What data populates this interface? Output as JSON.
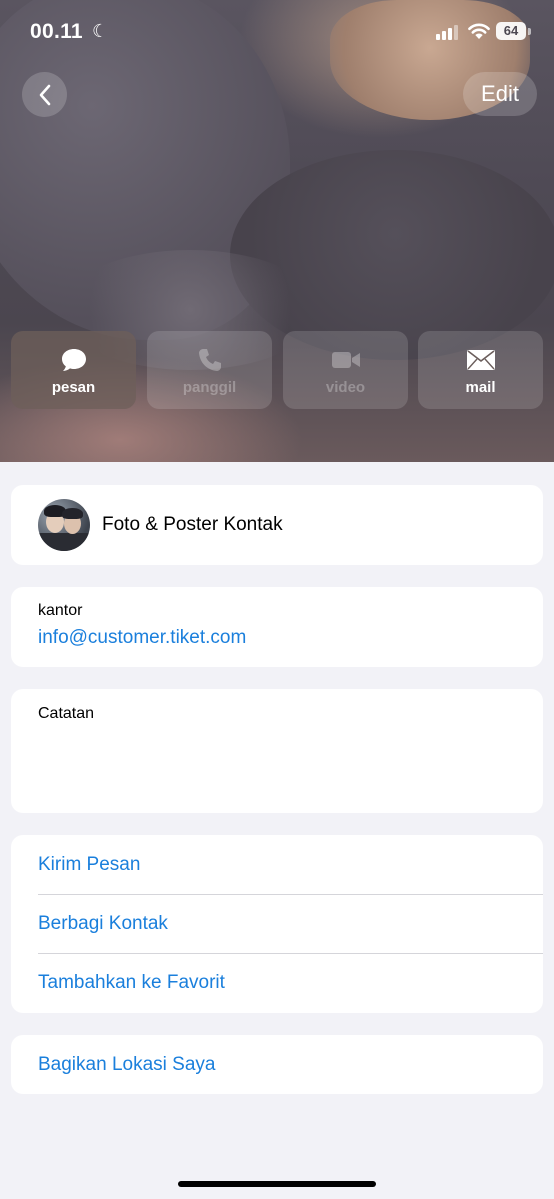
{
  "status_bar": {
    "time": "00.11",
    "focus_icon": "moon-icon",
    "battery": "64"
  },
  "header": {
    "back_icon": "chevron-left-icon",
    "edit_label": "Edit"
  },
  "actions": [
    {
      "label": "pesan",
      "icon": "message-bubble-icon",
      "enabled": true
    },
    {
      "label": "panggil",
      "icon": "phone-icon",
      "enabled": false
    },
    {
      "label": "video",
      "icon": "video-camera-icon",
      "enabled": false
    },
    {
      "label": "mail",
      "icon": "envelope-icon",
      "enabled": true
    }
  ],
  "photo_poster": {
    "label": "Foto & Poster Kontak"
  },
  "email": {
    "label": "kantor",
    "value": "info@customer.tiket.com"
  },
  "notes": {
    "label": "Catatan",
    "value": ""
  },
  "links": [
    {
      "label": "Kirim Pesan"
    },
    {
      "label": "Berbagi Kontak"
    },
    {
      "label": "Tambahkan ke Favorit"
    }
  ],
  "location": {
    "label": "Bagikan Lokasi Saya"
  },
  "colors": {
    "link_blue": "#1a7fdc",
    "background": "#f2f2f7"
  }
}
